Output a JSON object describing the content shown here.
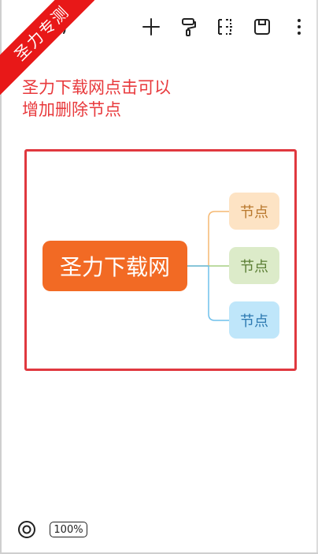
{
  "watermark": "圣力专测",
  "toolbar": {
    "buttons": [
      {
        "icon": "plus-icon"
      },
      {
        "icon": "paint-roller-icon"
      },
      {
        "icon": "layout-tree-icon"
      },
      {
        "icon": "save-icon"
      },
      {
        "icon": "more-vertical-icon"
      }
    ]
  },
  "instruction": {
    "line1": "圣力下载网点击可以",
    "line2": "增加删除节点",
    "color": "#e8393c"
  },
  "mindmap": {
    "root": {
      "label": "圣力下载网",
      "color": "#f26a24"
    },
    "children": [
      {
        "label": "节点",
        "bg": "#fde3c4",
        "text": "#b8772c",
        "line": "#f5b872"
      },
      {
        "label": "节点",
        "bg": "#dcebc9",
        "text": "#5a7d33",
        "line": "#a6cf82"
      },
      {
        "label": "节点",
        "bg": "#bfe6fa",
        "text": "#2b78b0",
        "line": "#6fc0ec"
      }
    ]
  },
  "footer": {
    "zoom": "100%"
  }
}
